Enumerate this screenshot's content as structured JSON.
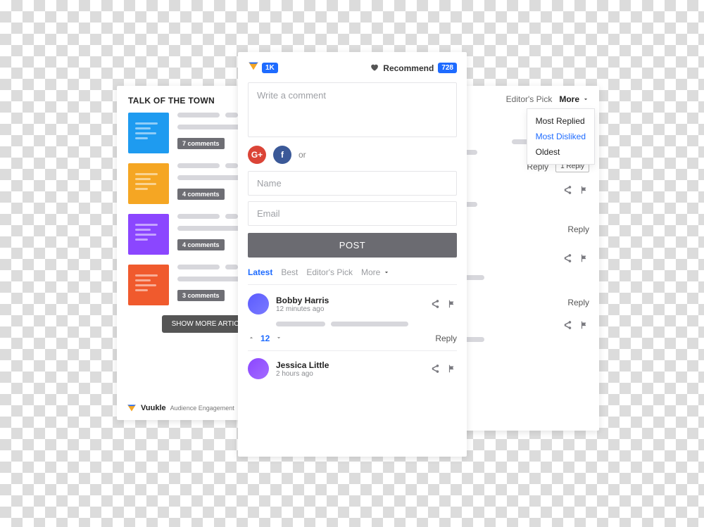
{
  "left": {
    "title": "TALK OF THE TOWN",
    "articles": [
      {
        "color": "#1e9bf0",
        "badge": "7 comments"
      },
      {
        "color": "#f5a623",
        "badge": "4 comments"
      },
      {
        "color": "#8b46ff",
        "badge": "4 comments"
      },
      {
        "color": "#f05a2d",
        "badge": "3 comments"
      }
    ],
    "show_more": "SHOW MORE ARTICLES",
    "brand": "Vuukle",
    "brand_sub": "Audience Engagement"
  },
  "right": {
    "tab_editors": "Editor's Pick",
    "tab_more": "More",
    "dropdown": {
      "opt1": "Most Replied",
      "opt2": "Most Disliked",
      "opt3": "Oldest"
    },
    "reply": "Reply",
    "reply_badge": "1 Reply"
  },
  "center": {
    "count_badge": "1K",
    "recommend": "Recommend",
    "recommend_count": "728",
    "placeholder": "Write a comment",
    "or": "or",
    "name_ph": "Name",
    "email_ph": "Email",
    "post": "POST",
    "tabs": {
      "latest": "Latest",
      "best": "Best",
      "editors": "Editor's Pick",
      "more": "More"
    },
    "comments": [
      {
        "name": "Bobby Harris",
        "time": "12 minutes ago",
        "votes": "12",
        "avatar": "#5b5bff"
      },
      {
        "name": "Jessica Little",
        "time": "2 hours ago",
        "avatar": "#8b46ff"
      }
    ],
    "reply": "Reply"
  }
}
